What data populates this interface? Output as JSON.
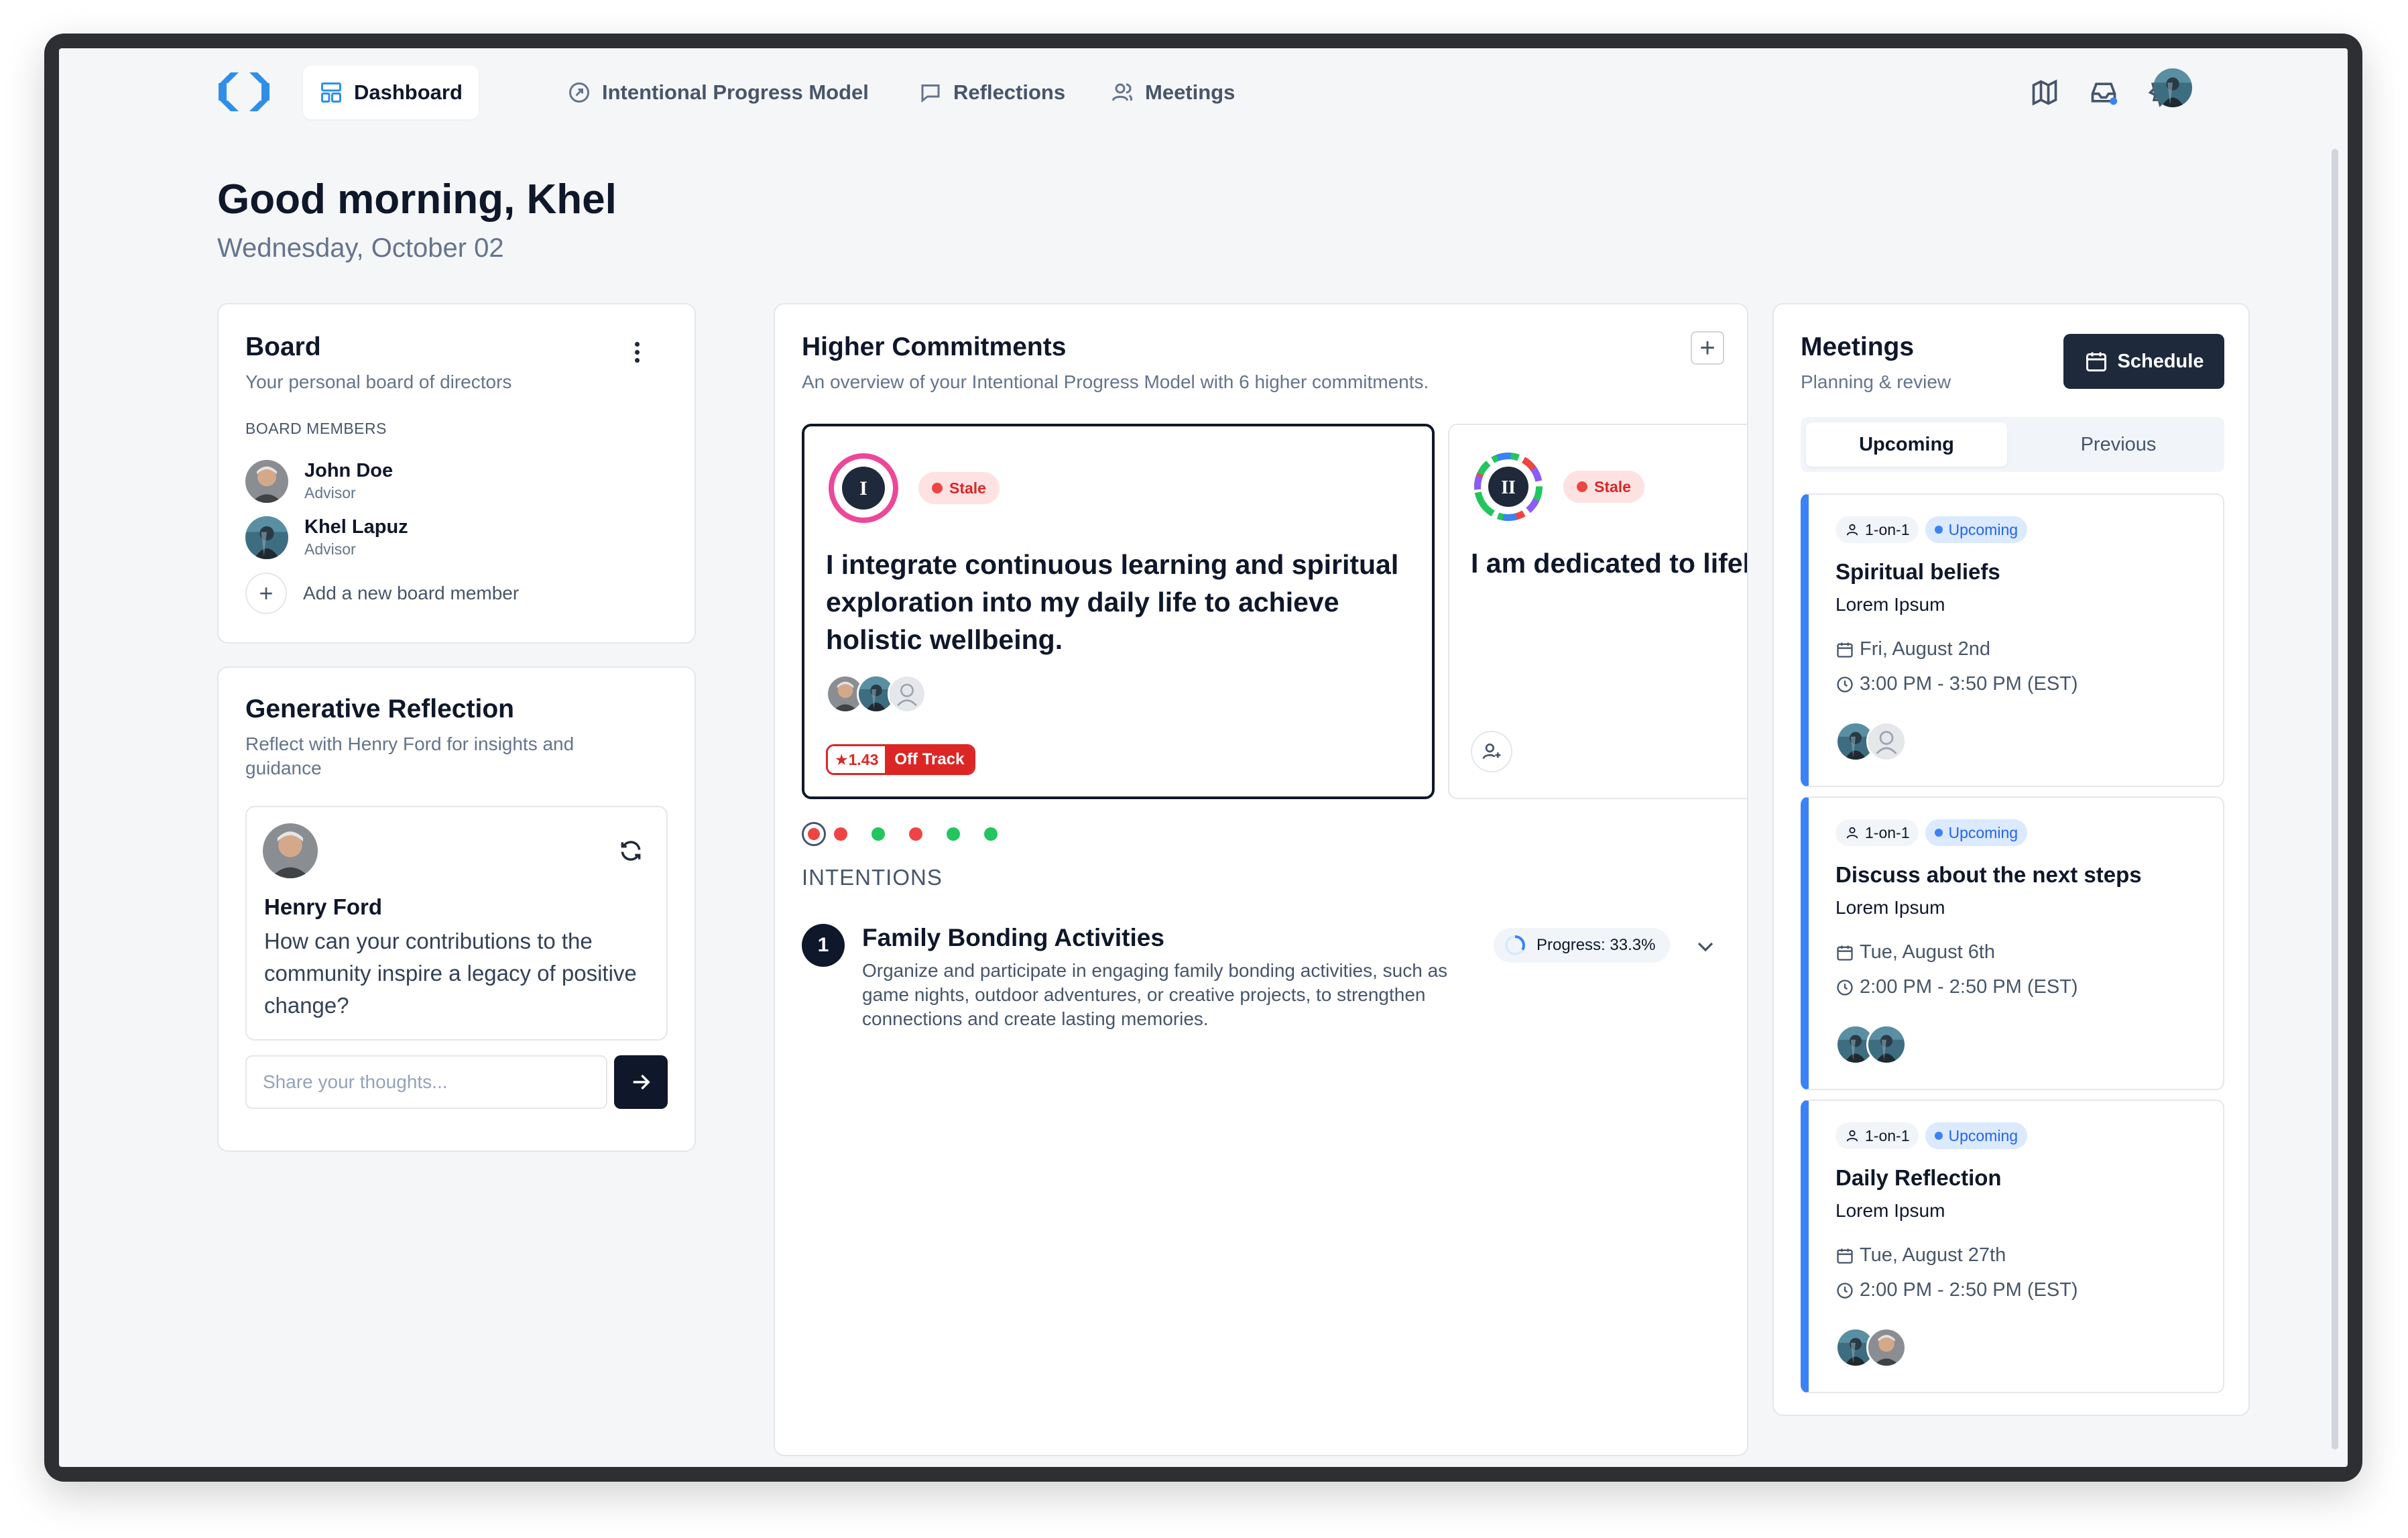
{
  "nav": {
    "tabs": [
      {
        "label": "Dashboard",
        "icon": "dashboard-icon",
        "active": true
      },
      {
        "label": "Intentional Progress Model",
        "icon": "compass-icon",
        "active": false
      },
      {
        "label": "Reflections",
        "icon": "chat-bubble-icon",
        "active": false
      },
      {
        "label": "Meetings",
        "icon": "users-icon",
        "active": false
      }
    ],
    "right_icons": [
      "map-icon",
      "inbox-icon",
      "gear-icon",
      "avatar"
    ]
  },
  "greeting": "Good morning, Khel",
  "date": "Wednesday, October 02",
  "board": {
    "title": "Board",
    "subtitle": "Your personal board of directors",
    "section_label": "BOARD MEMBERS",
    "members": [
      {
        "name": "John Doe",
        "role": "Advisor"
      },
      {
        "name": "Khel Lapuz",
        "role": "Advisor"
      }
    ],
    "add_label": "Add a new board member"
  },
  "generative": {
    "title": "Generative Reflection",
    "subtitle": "Reflect with Henry Ford for insights and guidance",
    "mentor_name": "Henry Ford",
    "question": "How can your contributions to the community inspire a legacy of positive change?",
    "input_placeholder": "Share your thoughts..."
  },
  "commitments": {
    "title": "Higher Commitments",
    "subtitle": "An overview of your Intentional Progress Model with 6 higher commitments.",
    "cards": [
      {
        "numeral": "I",
        "status": "Stale",
        "text": "I integrate continuous learning and spiritual exploration into my daily life to achieve holistic wellbeing.",
        "score": "1.43",
        "track": "Off Track"
      },
      {
        "numeral": "II",
        "status": "Stale",
        "text": "I am dedicated to lifelong learning, securing my financial future"
      }
    ],
    "dots": [
      "#ef4444",
      "#ef4444",
      "#22c55e",
      "#ef4444",
      "#22c55e",
      "#22c55e"
    ],
    "intentions_label": "INTENTIONS",
    "intentions": [
      {
        "number": "1",
        "title": "Family Bonding Activities",
        "description": "Organize and participate in engaging family bonding activities, such as game nights, outdoor adventures, or creative projects, to strengthen connections and create lasting memories.",
        "progress_label": "Progress: 33.3%",
        "progress": 0.333
      }
    ]
  },
  "meetings": {
    "title": "Meetings",
    "subtitle": "Planning & review",
    "schedule_label": "Schedule",
    "tabs": [
      "Upcoming",
      "Previous"
    ],
    "items": [
      {
        "type": "1-on-1",
        "status": "Upcoming",
        "title": "Spiritual beliefs",
        "sub": "Lorem Ipsum",
        "date": "Fri, August 2nd",
        "time": "3:00 PM - 3:50 PM (EST)"
      },
      {
        "type": "1-on-1",
        "status": "Upcoming",
        "title": "Discuss about the next steps",
        "sub": "Lorem Ipsum",
        "date": "Tue, August 6th",
        "time": "2:00 PM - 2:50 PM (EST)"
      },
      {
        "type": "1-on-1",
        "status": "Upcoming",
        "title": "Daily Reflection",
        "sub": "Lorem Ipsum",
        "date": "Tue, August 27th",
        "time": "2:00 PM - 2:50 PM (EST)"
      }
    ]
  },
  "colors": {
    "accent": "#3b82f6",
    "danger": "#dc2626",
    "success": "#22c55e",
    "dark": "#0f172a"
  }
}
